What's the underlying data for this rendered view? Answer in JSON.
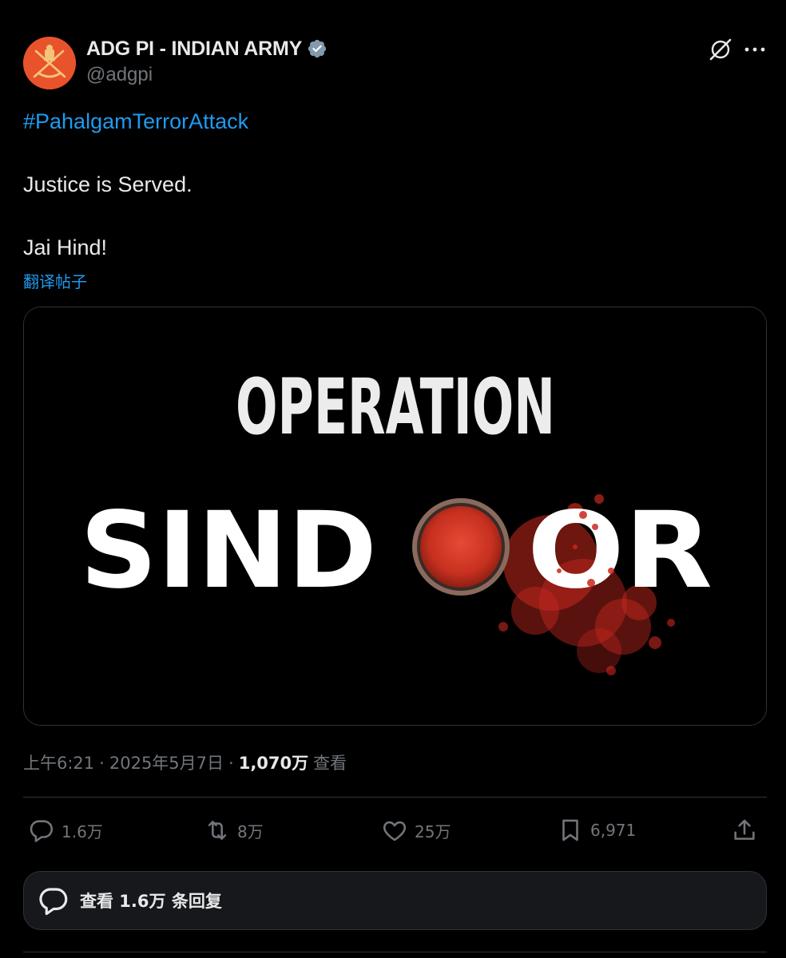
{
  "author": {
    "display_name": "ADG PI - INDIAN ARMY",
    "handle": "@adgpi",
    "avatar_icon": "indian-army-emblem-icon",
    "verified_icon": "verified-badge-icon",
    "avatar_color": "#e8532b"
  },
  "post": {
    "hashtag": "#PahalgamTerrorAttack",
    "lines": [
      "Justice is Served.",
      "Jai Hind!"
    ],
    "translate_label": "翻译帖子"
  },
  "media": {
    "line1": "OPERATION",
    "line2_left": "SIND",
    "line2_right": "OR"
  },
  "meta": {
    "time": "上午6:21",
    "separator": "·",
    "date": "2025年5月7日",
    "views_count": "1,070万",
    "views_label": "查看"
  },
  "actions": {
    "replies": "1.6万",
    "reposts": "8万",
    "likes": "25万",
    "bookmarks": "6,971"
  },
  "replies_button": {
    "label": "查看 1.6万 条回复"
  },
  "colors": {
    "background": "#000000",
    "text": "#e7e9ea",
    "muted": "#71767b",
    "link": "#1d9bf0",
    "border": "#2f3336",
    "sindoor_red": "#d8382a"
  },
  "icons": [
    "grok-icon",
    "more-icon",
    "reply-icon",
    "repost-icon",
    "like-icon",
    "bookmark-icon",
    "share-icon",
    "replies-bubble-icon"
  ]
}
